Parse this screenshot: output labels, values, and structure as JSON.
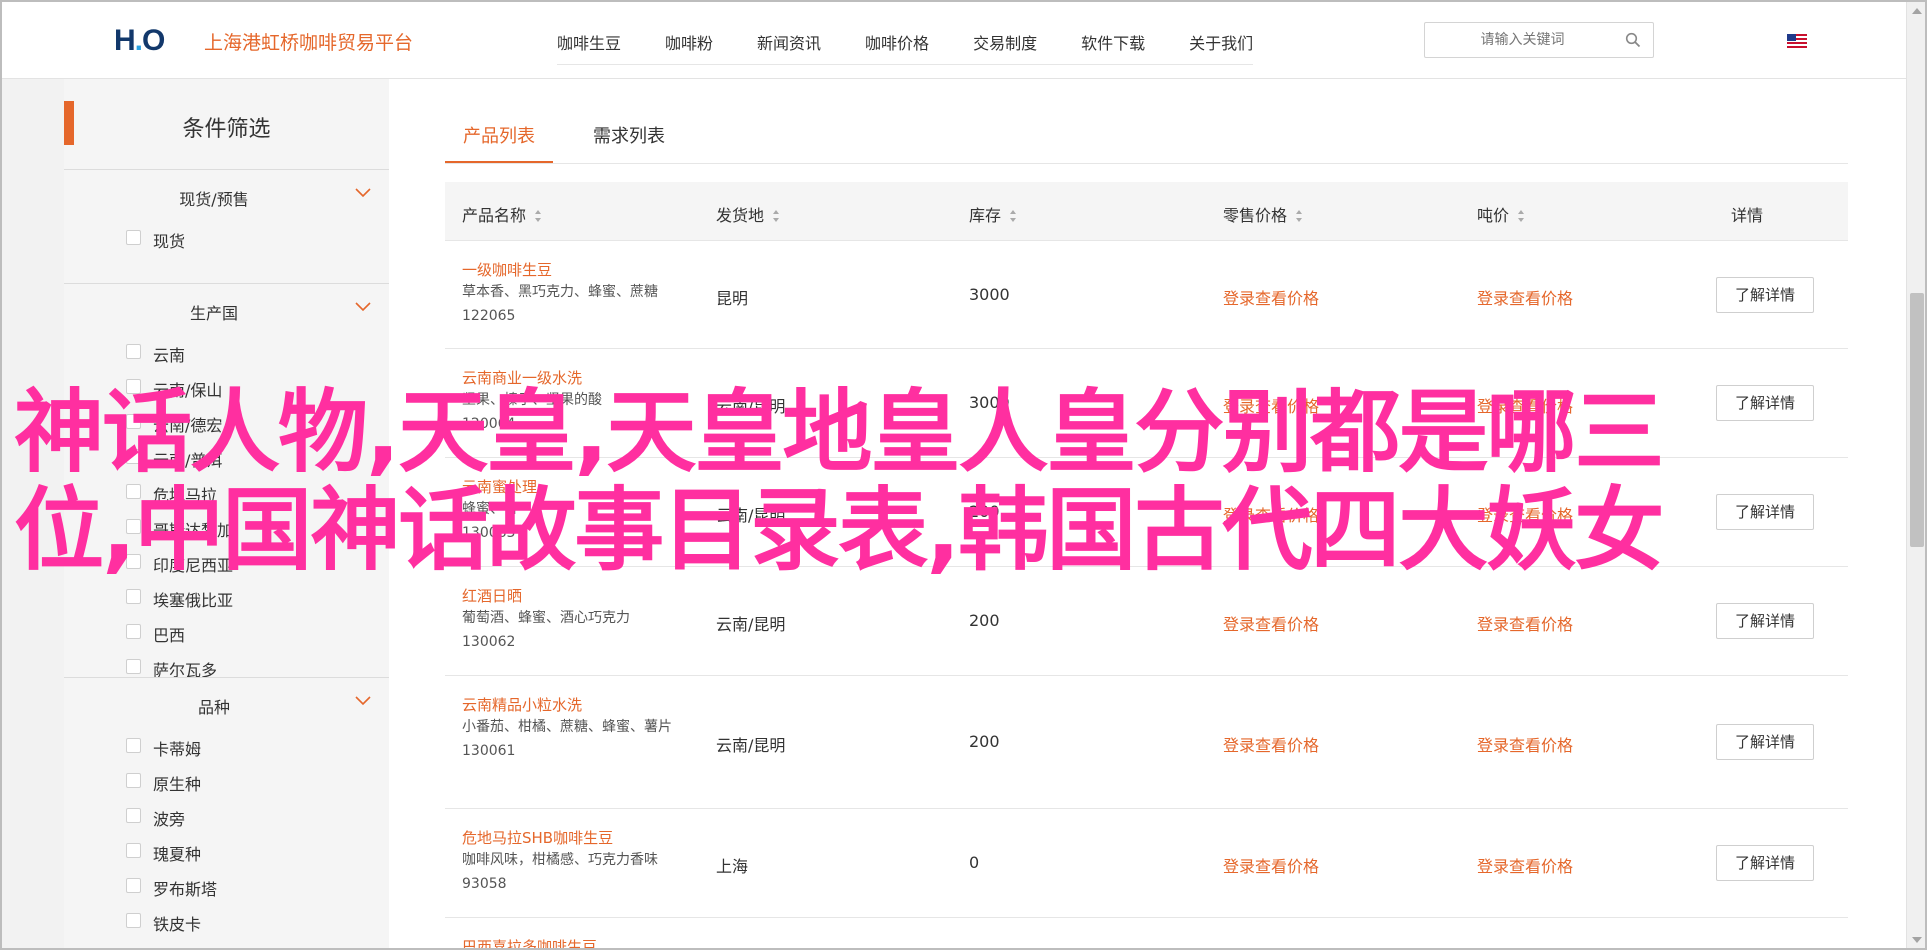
{
  "header": {
    "site_title": "上海港虹桥咖啡贸易平台",
    "logo_text": "H",
    "logo_text_2": "O",
    "nav": [
      "咖啡生豆",
      "咖啡粉",
      "新闻资讯",
      "咖啡价格",
      "交易制度",
      "软件下载",
      "关于我们"
    ],
    "search_placeholder": "请输入关键词",
    "icons": {
      "search": "search-icon",
      "flag": "us-flag-icon"
    }
  },
  "sidebar": {
    "title": "条件筛选",
    "groups": [
      {
        "label": "现货/预售",
        "options": [
          "现货"
        ]
      },
      {
        "label": "生产国",
        "options": [
          "云南",
          "云南/保山",
          "云南/德宏",
          "云南/普洱",
          "危地马拉",
          "哥斯达黎加",
          "印度尼西亚",
          "埃塞俄比亚",
          "巴西",
          "萨尔瓦多"
        ]
      },
      {
        "label": "品种",
        "options": [
          "卡蒂姆",
          "原生种",
          "波旁",
          "瑰夏种",
          "罗布斯塔",
          "铁皮卡"
        ]
      }
    ]
  },
  "tabs": [
    "产品列表",
    "需求列表"
  ],
  "table": {
    "headers": [
      "产品名称",
      "发货地",
      "库存",
      "零售价格",
      "吨价",
      "详情"
    ],
    "rows": [
      {
        "name": "一级咖啡生豆",
        "desc": "草本香、黑巧克力、蜂蜜、蔗糖",
        "code": "122065",
        "origin": "昆明",
        "stock": "3000",
        "retail": "登录查看价格",
        "ton": "登录查看价格",
        "btn": "了解详情"
      },
      {
        "name": "云南商业一级水洗",
        "desc": "坚果、榛子、坚果的酸",
        "code": "120064",
        "origin": "云南/昆明",
        "stock": "3000",
        "retail": "登录查看价格",
        "ton": "登录查看价格",
        "btn": "了解详情"
      },
      {
        "name": "云南蜜处理",
        "desc": "蜂蜜、杏",
        "code": "130063",
        "origin": "云南/昆明",
        "stock": "200",
        "retail": "登录查看价格",
        "ton": "登录查看价格",
        "btn": "了解详情"
      },
      {
        "name": "红酒日晒",
        "desc": "葡萄酒、蜂蜜、酒心巧克力",
        "code": "130062",
        "origin": "云南/昆明",
        "stock": "200",
        "retail": "登录查看价格",
        "ton": "登录查看价格",
        "btn": "了解详情"
      },
      {
        "name": "云南精品小粒水洗",
        "desc": "小番茄、柑橘、蔗糖、蜂蜜、薯片",
        "code": "130061",
        "origin": "云南/昆明",
        "stock": "200",
        "retail": "登录查看价格",
        "ton": "登录查看价格",
        "btn": "了解详情"
      },
      {
        "name": "危地马拉SHB咖啡生豆",
        "desc": "咖啡风味，柑橘感、巧克力香味",
        "code": "93058",
        "origin": "上海",
        "stock": "0",
        "retail": "登录查看价格",
        "ton": "登录查看价格",
        "btn": "了解详情"
      },
      {
        "name": "巴西喜拉多咖啡生豆",
        "desc": "",
        "code": "",
        "origin": "",
        "stock": "",
        "retail": "",
        "ton": "",
        "btn": ""
      }
    ]
  },
  "overlay": {
    "line1": "神话人物,天皇,天皇地皇人皇分别都是哪三",
    "line2": "位,中国神话故事目录表,韩国古代四大妖女"
  },
  "colors": {
    "accent": "#e5672b",
    "overlay": "#ff2fa0",
    "logo": "#12386b"
  }
}
